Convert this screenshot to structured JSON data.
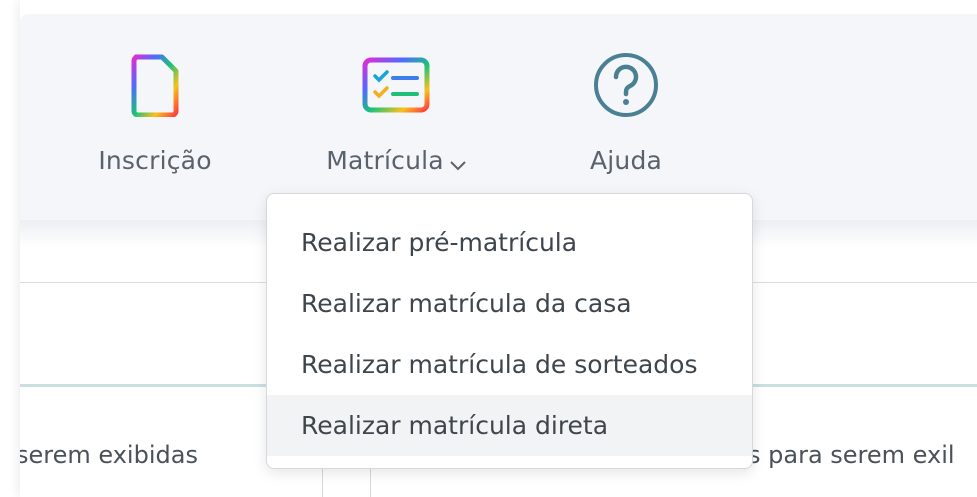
{
  "nav": {
    "items": [
      {
        "label": "Inscrição",
        "icon": "document-icon"
      },
      {
        "label": "Matrícula",
        "icon": "checklist-icon",
        "has_dropdown": true
      },
      {
        "label": "Ajuda",
        "icon": "help-circle-icon"
      }
    ]
  },
  "dropdown": {
    "items": [
      {
        "label": "Realizar pré-matrícula"
      },
      {
        "label": "Realizar matrícula da casa"
      },
      {
        "label": "Realizar matrícula de sorteados"
      },
      {
        "label": "Realizar matrícula direta",
        "highlighted": true
      }
    ]
  },
  "table": {
    "left_text": "serem exibidas",
    "right_text": "s para serem exil"
  },
  "colors": {
    "help_icon": "#4a7f94",
    "menu_text": "#3e454c",
    "accent_line": "#c9dfe2"
  }
}
